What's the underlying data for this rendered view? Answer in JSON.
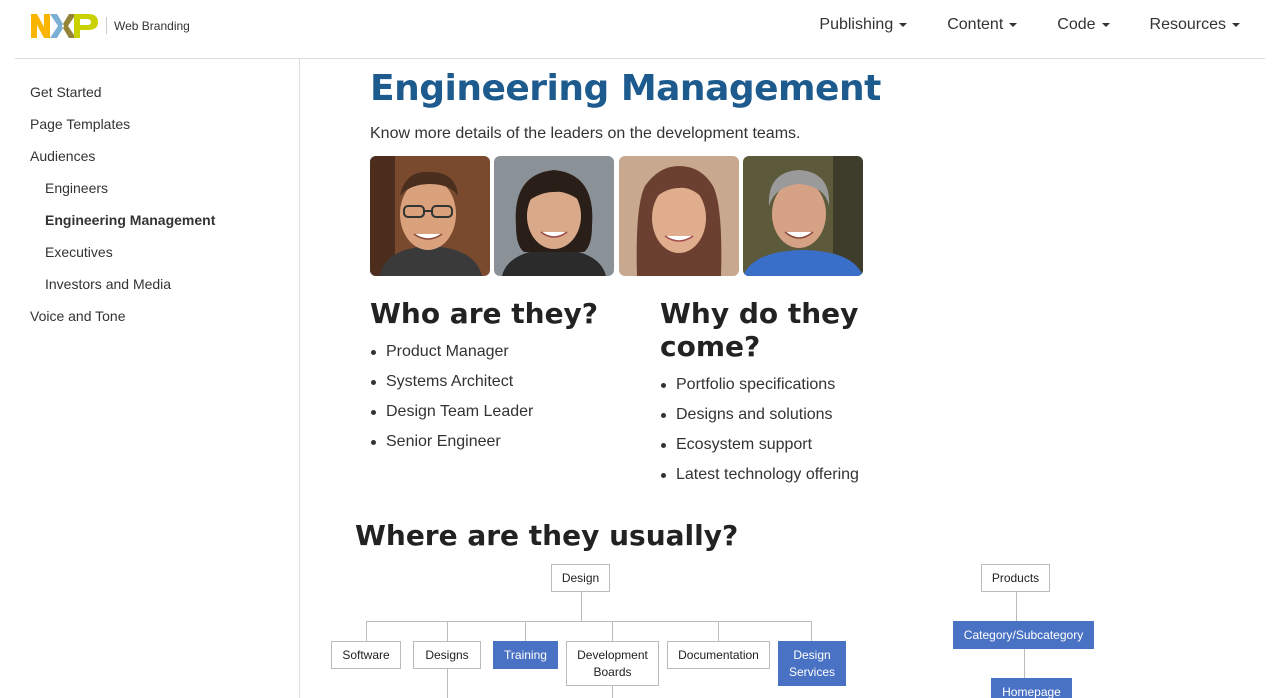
{
  "header": {
    "brand_text": "Web Branding",
    "logo_colors": {
      "n": "#f9b500",
      "x_left": "#7bafd4",
      "x_right": "#958437",
      "p": "#c9d200"
    },
    "nav": [
      {
        "label": "Publishing"
      },
      {
        "label": "Content"
      },
      {
        "label": "Code"
      },
      {
        "label": "Resources"
      }
    ]
  },
  "sidebar": {
    "items": [
      {
        "label": "Get Started",
        "level": 1
      },
      {
        "label": "Page Templates",
        "level": 1
      },
      {
        "label": "Audiences",
        "level": 1
      },
      {
        "label": "Engineers",
        "level": 2
      },
      {
        "label": "Engineering Management",
        "level": 2,
        "active": true
      },
      {
        "label": "Executives",
        "level": 2
      },
      {
        "label": "Investors and Media",
        "level": 2
      },
      {
        "label": "Voice and Tone",
        "level": 1
      }
    ]
  },
  "main": {
    "title": "Engineering Management",
    "title_color": "#1d5b8f",
    "lead": "Know more details of the leaders on the development teams.",
    "who": {
      "heading": "Who are they?",
      "items": [
        "Product Manager",
        "Systems Architect",
        "Design Team Leader",
        "Senior Engineer"
      ]
    },
    "why": {
      "heading_line1": "Why do they",
      "heading_line2": "come?",
      "items": [
        "Portfolio specifications",
        "Designs and solutions",
        "Ecosystem support",
        "Latest technology offering"
      ]
    },
    "where": {
      "heading": "Where are they usually?"
    }
  },
  "diagram": {
    "highlight_color": "#4a72c4",
    "design": "Design",
    "software": "Software",
    "designs": "Designs",
    "training": "Training",
    "dev_boards_l1": "Development",
    "dev_boards_l2": "Boards",
    "documentation": "Documentation",
    "design_services_l1": "Design",
    "design_services_l2": "Services",
    "products": "Products",
    "category": "Category/Subcategory",
    "homepage": "Homepage"
  }
}
